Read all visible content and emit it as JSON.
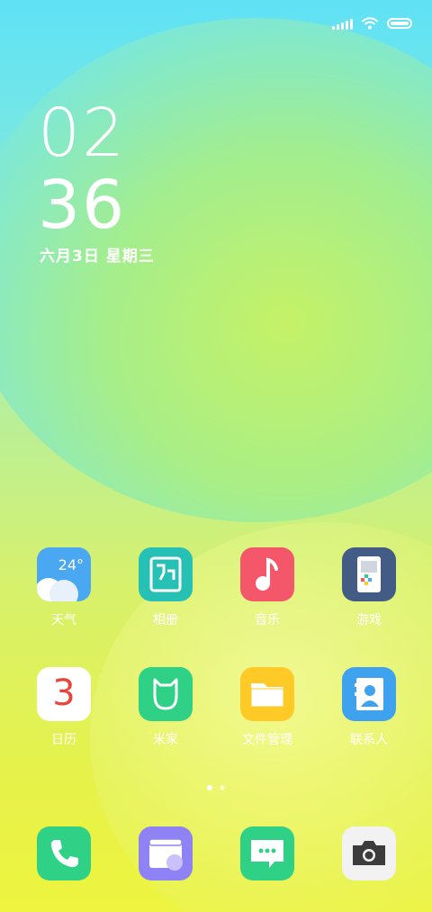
{
  "status_bar": {
    "signal_icon": "signal-icon",
    "wifi_icon": "wifi-icon",
    "battery_icon": "battery-icon"
  },
  "clock": {
    "hours": "02",
    "minutes": "36",
    "date": "六月3日 星期三"
  },
  "apps_row1": [
    {
      "label": "天气",
      "icon": "weather-icon",
      "temp": "24°",
      "color": "#4aa8f2"
    },
    {
      "label": "相册",
      "icon": "gallery-icon",
      "color": "#27c0b4"
    },
    {
      "label": "音乐",
      "icon": "music-icon",
      "color": "#f4566a"
    },
    {
      "label": "游戏",
      "icon": "game-icon",
      "color": "#425c85"
    }
  ],
  "apps_row2": [
    {
      "label": "日历",
      "icon": "calendar-icon",
      "day": "3",
      "color": "#ffffff"
    },
    {
      "label": "米家",
      "icon": "mijia-icon",
      "color": "#2fd187"
    },
    {
      "label": "文件管理",
      "icon": "folder-icon",
      "color": "#ffc926"
    },
    {
      "label": "联系人",
      "icon": "contacts-icon",
      "color": "#3fa2ee"
    }
  ],
  "page_indicator": {
    "pages": 2,
    "current": 1
  },
  "dock": [
    {
      "icon": "phone-icon",
      "color": "#2fd187"
    },
    {
      "icon": "browser-icon",
      "color": "#8f82f5"
    },
    {
      "icon": "messages-icon",
      "color": "#2fd187"
    },
    {
      "icon": "camera-icon",
      "color": "#f2f2f2"
    }
  ]
}
